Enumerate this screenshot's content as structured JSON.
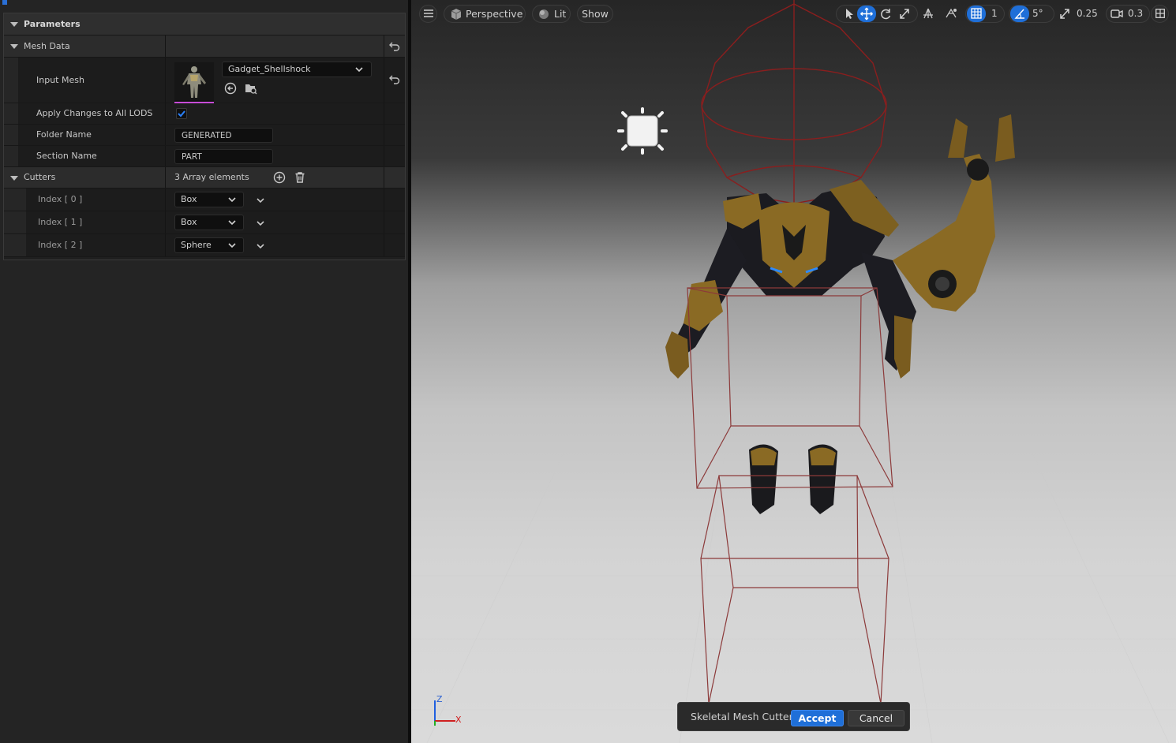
{
  "details_panel": {
    "section_title": "Parameters",
    "mesh_data": {
      "label": "Mesh Data",
      "input_mesh_label": "Input Mesh",
      "input_mesh_value": "Gadget_Shellshock",
      "apply_changes_label": "Apply Changes to All LODS",
      "apply_changes_checked": true,
      "folder_name_label": "Folder Name",
      "folder_name_value": "GENERATED",
      "section_name_label": "Section Name",
      "section_name_value": "PART"
    },
    "cutters": {
      "label": "Cutters",
      "count_text": "3 Array elements",
      "items": [
        {
          "index_label": "Index [ 0 ]",
          "type": "Box"
        },
        {
          "index_label": "Index [ 1 ]",
          "type": "Box"
        },
        {
          "index_label": "Index [ 2 ]",
          "type": "Sphere"
        }
      ]
    }
  },
  "viewport_toolbar": {
    "view_mode": "Perspective",
    "lighting_mode": "Lit",
    "show_label": "Show",
    "grid_snap_value": "1",
    "rotation_snap_value": "5°",
    "scale_snap_value": "0.25",
    "camera_speed_value": "0.3"
  },
  "axis_gizmo": {
    "z_label": "Z",
    "x_label": "X"
  },
  "tool_bar": {
    "title": "Skeletal Mesh Cutter",
    "accept_label": "Accept",
    "cancel_label": "Cancel"
  },
  "colors": {
    "accent": "#1f6fd8",
    "cutter_wire": "#8a2020",
    "armor_gold": "#8a6a24"
  }
}
